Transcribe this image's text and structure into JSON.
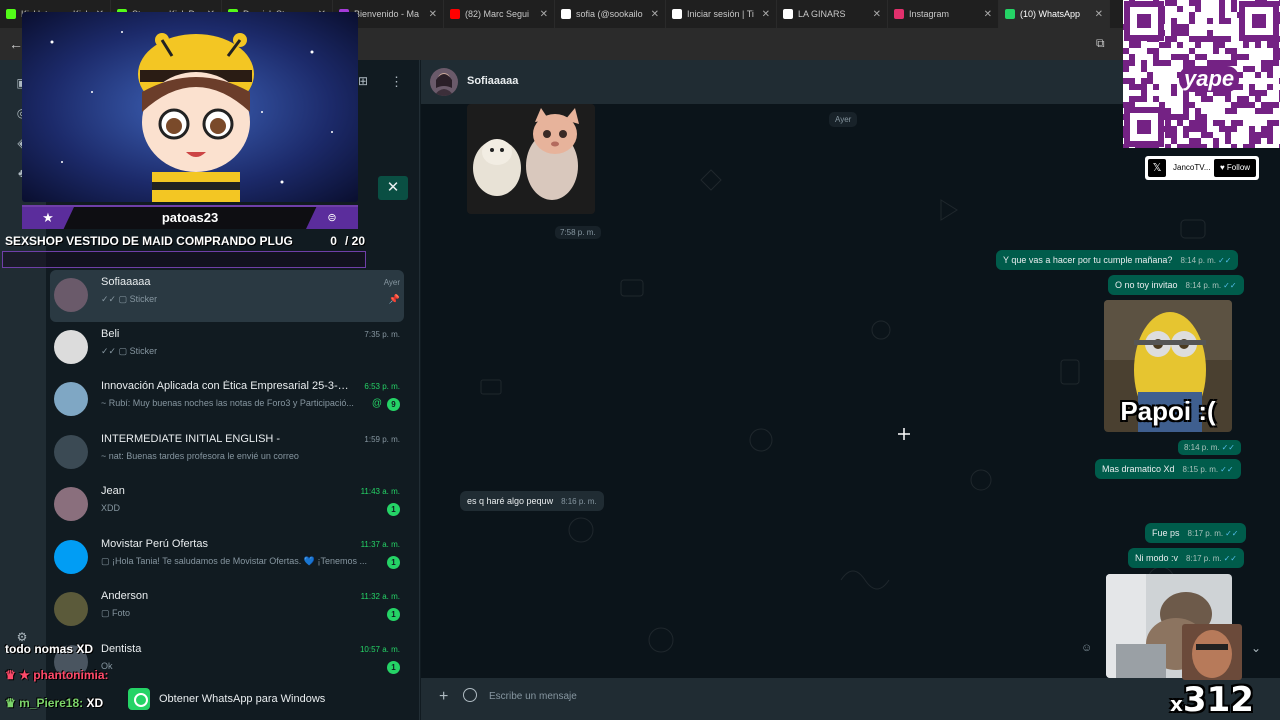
{
  "browser": {
    "tabs": [
      {
        "label": "Kicklet.app - Kick",
        "color": "#53fc18"
      },
      {
        "label": "Stream - Kick Da",
        "color": "#53fc18"
      },
      {
        "label": "Daarick Stream",
        "color": "#53fc18"
      },
      {
        "label": "Bienvenido - Ma",
        "color": "#a43bd8"
      },
      {
        "label": "(82) Marc Segui",
        "color": "#ff0000"
      },
      {
        "label": "sofia (@sookailo",
        "color": "#ffffff"
      },
      {
        "label": "Iniciar sesión | Ti",
        "color": "#ffffff"
      },
      {
        "label": "LA GINARS",
        "color": "#ffffff"
      },
      {
        "label": "Instagram",
        "color": "#e1306c"
      },
      {
        "label": "(10) WhatsApp",
        "color": "#25d366"
      }
    ],
    "active_tab": 9
  },
  "chat_list": [
    {
      "name": "Sofiaaaaa",
      "preview": "✓✓ ▢ Sticker",
      "time": "Ayer",
      "pinned": true,
      "active": true,
      "avatar_color": "#6a5a6a"
    },
    {
      "name": "Beli",
      "preview": "✓✓ ▢ Sticker",
      "time": "7:35 p. m.",
      "avatar_color": "#dcdcdc"
    },
    {
      "name": "Innovación Aplicada con Ética Empresarial 25-3-302...",
      "preview": "~ Rubí: Muy buenas noches las notas de Foro3 y Participació...",
      "time": "6:53 p. m.",
      "time_green": true,
      "badge": "9",
      "mention": "@",
      "avatar_color": "#7fa7c4"
    },
    {
      "name": "INTERMEDIATE INITIAL ENGLISH -",
      "preview": "~ nat: Buenas tardes profesora le envié un correo",
      "time": "1:59 p. m.",
      "avatar_color": "#3b4a54"
    },
    {
      "name": "Jean",
      "preview": "XDD",
      "time": "11:43 a. m.",
      "time_green": true,
      "badge": "1",
      "avatar_color": "#8a6f7d"
    },
    {
      "name": "Movistar Perú Ofertas",
      "preview": "▢ ¡Hola Tania! Te saludamos de Movistar Ofertas. 💙 ¡Tenemos ...",
      "time": "11:37 a. m.",
      "time_green": true,
      "badge": "1",
      "avatar_color": "#019df4"
    },
    {
      "name": "Anderson",
      "preview": "▢ Foto",
      "time": "11:32 a. m.",
      "time_green": true,
      "badge": "1",
      "avatar_color": "#5b5a3a"
    },
    {
      "name": "Dentista",
      "preview": "Ok",
      "time": "10:57 a. m.",
      "time_green": true,
      "badge": "1",
      "avatar_color": "#4a5560"
    }
  ],
  "get_whatsapp": "Obtener WhatsApp para Windows",
  "conversation": {
    "contact": "Sofiaaaaa",
    "day_separator": "Ayer",
    "sticker_time": "7:58 p. m.",
    "messages": [
      {
        "dir": "out",
        "text": "Y que vas a hacer por tu cumple mañana?",
        "time": "8:14 p. m."
      },
      {
        "dir": "out",
        "text": "O no toy invitao",
        "time": "8:14 p. m."
      },
      {
        "dir": "out",
        "text": "Mas dramatico Xd",
        "time": "8:15 p. m."
      },
      {
        "dir": "in",
        "text": "es q haré algo pequw",
        "time": "8:16 p. m."
      },
      {
        "dir": "out",
        "text": "Fue ps",
        "time": "8:17 p. m."
      },
      {
        "dir": "out",
        "text": "Ni modo :v",
        "time": "8:17 p. m."
      }
    ],
    "image_caption": "Papoi :(",
    "image_time": "8:14 p. m.",
    "composer_placeholder": "Escribe un mensaje",
    "ticks": "✓✓"
  },
  "stream": {
    "streamer_name": "patoas23",
    "goal_text": "SEXSHOP VESTIDO DE MAID COMPRANDO PLUG",
    "goal_count": "0",
    "goal_total": "/ 20",
    "goal_progress": 0.0,
    "accent_color": "#6f3fa8",
    "qr_brand": "yape",
    "follow_handle": "JancoTV...",
    "follow_label": "Follow",
    "chat": [
      {
        "user": "todo nomas XD",
        "text": ""
      },
      {
        "user": "phantonimia:",
        "text": ""
      },
      {
        "user": "m_Piere18:",
        "text": "XD"
      }
    ],
    "multiplier_prefix": "x",
    "multiplier_value": "312"
  }
}
